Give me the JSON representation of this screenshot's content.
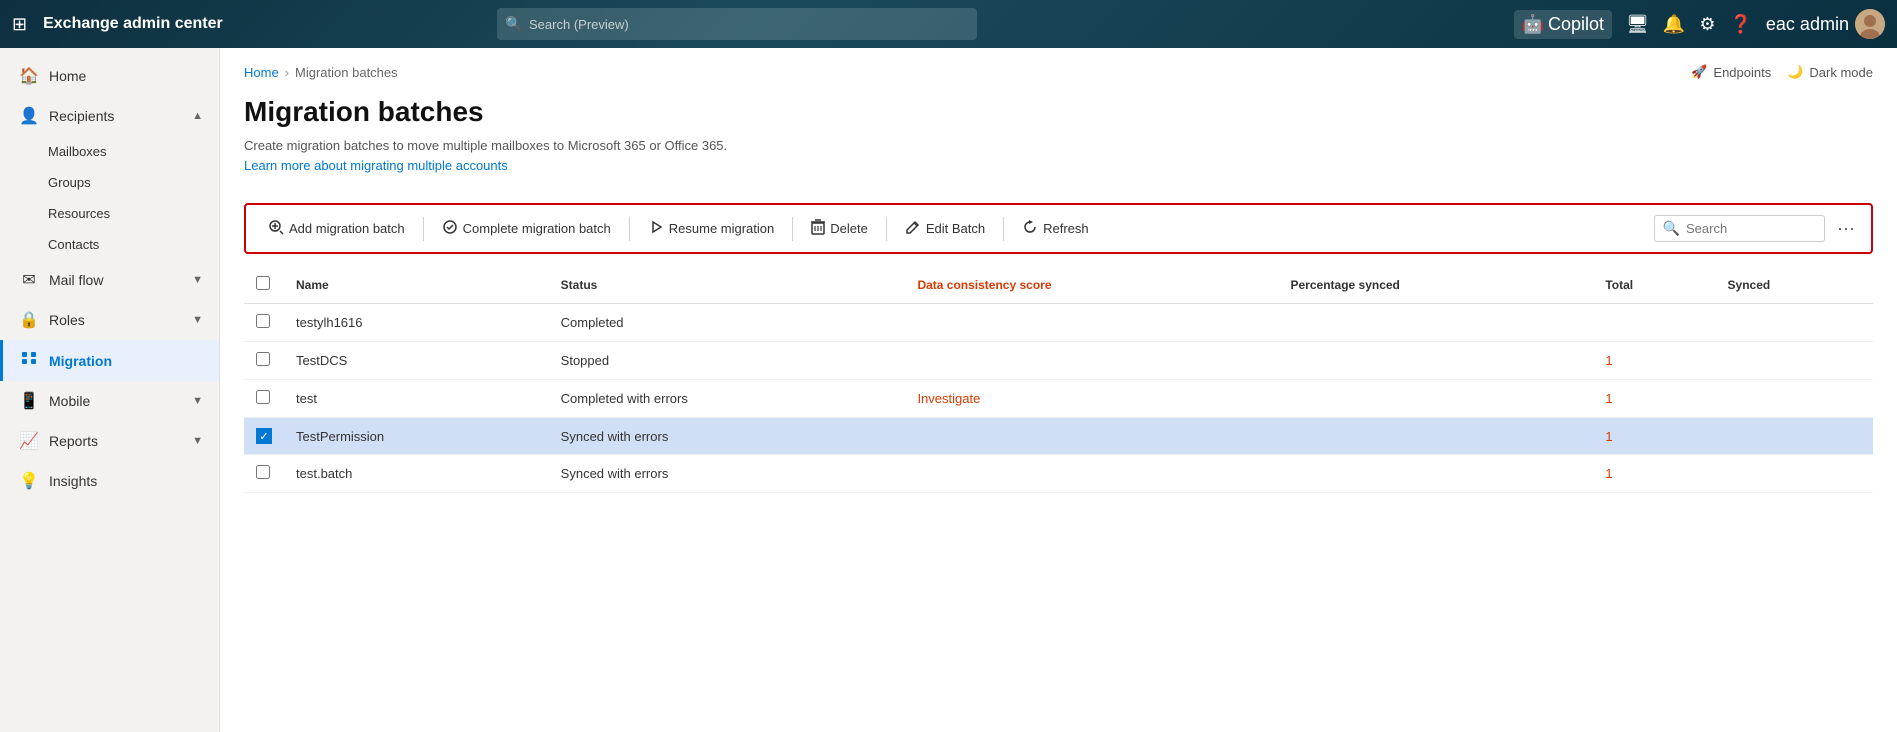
{
  "topbar": {
    "title": "Exchange admin center",
    "search_placeholder": "Search (Preview)",
    "copilot_label": "Copilot",
    "user_label": "eac admin"
  },
  "breadcrumb": {
    "home": "Home",
    "current": "Migration batches",
    "endpoints_label": "Endpoints",
    "dark_mode_label": "Dark mode"
  },
  "page": {
    "title": "Migration batches",
    "description": "Create migration batches to move multiple mailboxes to Microsoft 365 or Office 365.",
    "learn_more": "Learn more about migrating multiple accounts"
  },
  "toolbar": {
    "add_label": "Add migration batch",
    "complete_label": "Complete migration batch",
    "resume_label": "Resume migration",
    "delete_label": "Delete",
    "edit_label": "Edit Batch",
    "refresh_label": "Refresh",
    "search_placeholder": "Search"
  },
  "table": {
    "columns": [
      "Name",
      "Status",
      "Data consistency score",
      "Percentage synced",
      "Total",
      "Synced"
    ],
    "rows": [
      {
        "name": "testylh1616",
        "status": "Completed",
        "consistency": "",
        "pct_synced": "",
        "total": "",
        "synced": "",
        "selected": false
      },
      {
        "name": "TestDCS",
        "status": "Stopped",
        "consistency": "",
        "pct_synced": "",
        "total": "1",
        "synced": "",
        "selected": false
      },
      {
        "name": "test",
        "status": "Completed with errors",
        "consistency": "Investigate",
        "pct_synced": "",
        "total": "1",
        "synced": "",
        "selected": false
      },
      {
        "name": "TestPermission",
        "status": "Synced with errors",
        "consistency": "",
        "pct_synced": "",
        "total": "1",
        "synced": "",
        "selected": true
      },
      {
        "name": "test.batch",
        "status": "Synced with errors",
        "consistency": "",
        "pct_synced": "",
        "total": "1",
        "synced": "",
        "selected": false
      }
    ]
  },
  "sidebar": {
    "items": [
      {
        "id": "home",
        "label": "Home",
        "icon": "🏠",
        "hasChildren": false
      },
      {
        "id": "recipients",
        "label": "Recipients",
        "icon": "👤",
        "hasChildren": true,
        "expanded": true,
        "children": [
          {
            "id": "mailboxes",
            "label": "Mailboxes"
          },
          {
            "id": "groups",
            "label": "Groups"
          },
          {
            "id": "resources",
            "label": "Resources"
          },
          {
            "id": "contacts",
            "label": "Contacts"
          }
        ]
      },
      {
        "id": "mailflow",
        "label": "Mail flow",
        "icon": "✉",
        "hasChildren": true
      },
      {
        "id": "roles",
        "label": "Roles",
        "icon": "🔒",
        "hasChildren": true
      },
      {
        "id": "migration",
        "label": "Migration",
        "icon": "📊",
        "hasChildren": false,
        "active": true
      },
      {
        "id": "mobile",
        "label": "Mobile",
        "icon": "📱",
        "hasChildren": true
      },
      {
        "id": "reports",
        "label": "Reports",
        "icon": "📈",
        "hasChildren": true
      },
      {
        "id": "insights",
        "label": "Insights",
        "icon": "💡",
        "hasChildren": false
      }
    ]
  }
}
